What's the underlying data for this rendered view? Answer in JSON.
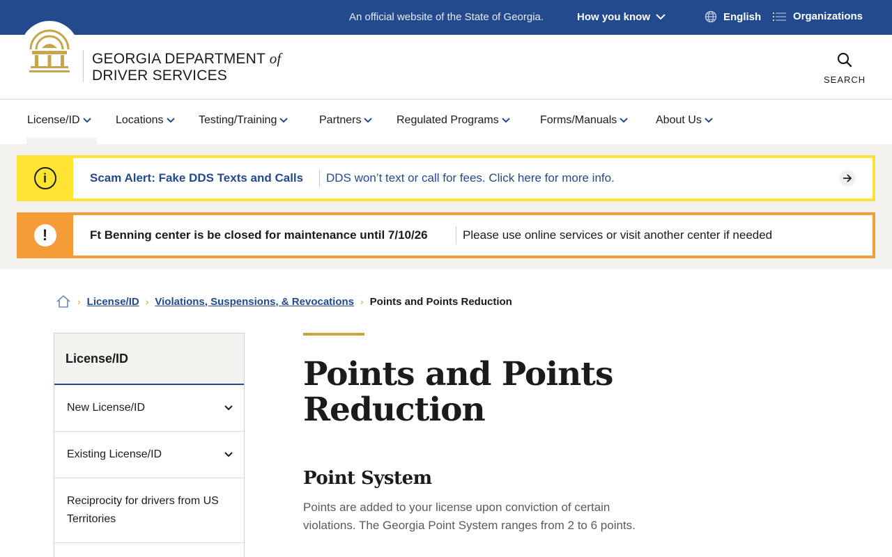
{
  "gov_banner": {
    "official_text": "An official website of the State of Georgia.",
    "how_you_know": "How you know",
    "language": "English",
    "organizations": "Organizations"
  },
  "header": {
    "brand_line1": "GEORGIA DEPARTMENT",
    "brand_of": "of",
    "brand_line2": "DRIVER SERVICES",
    "search_label": "SEARCH"
  },
  "main_nav": {
    "items": [
      {
        "label": "License/ID"
      },
      {
        "label": "Locations"
      },
      {
        "label": "Testing/Training"
      },
      {
        "label": "Partners"
      },
      {
        "label": "Regulated Programs"
      },
      {
        "label": "Forms/Manuals"
      },
      {
        "label": "About Us"
      }
    ]
  },
  "alerts": [
    {
      "type": "info",
      "color": "#fde432",
      "title": "Scam Alert: Fake DDS Texts and Calls",
      "message": "DDS won’t text or call for fees. Click here for more info."
    },
    {
      "type": "warning",
      "color": "#f49c37",
      "title": "Ft Benning center is be closed for maintenance until 7/10/26",
      "message": "Please use online services or visit another center if needed"
    }
  ],
  "breadcrumb": {
    "items": [
      "License/ID",
      "Violations, Suspensions, & Revocations"
    ],
    "current": "Points and Points Reduction"
  },
  "sidenav": {
    "heading": "License/ID",
    "items": [
      {
        "label": "New License/ID",
        "expandable": true
      },
      {
        "label": "Existing License/ID",
        "expandable": true
      },
      {
        "label": "Reciprocity for drivers from US Territories",
        "expandable": false
      }
    ]
  },
  "content": {
    "title": "Points and Points Reduction",
    "section_title": "Point System",
    "paragraph": "Points are added to your license upon conviction of certain violations.  The Georgia Point System ranges from 2 to 6 points."
  },
  "colors": {
    "navy": "#234a8c",
    "gold": "#c8a44a",
    "alert_yellow": "#fde432",
    "alert_orange": "#f49c37",
    "panel_bg": "#f4f2ee"
  }
}
